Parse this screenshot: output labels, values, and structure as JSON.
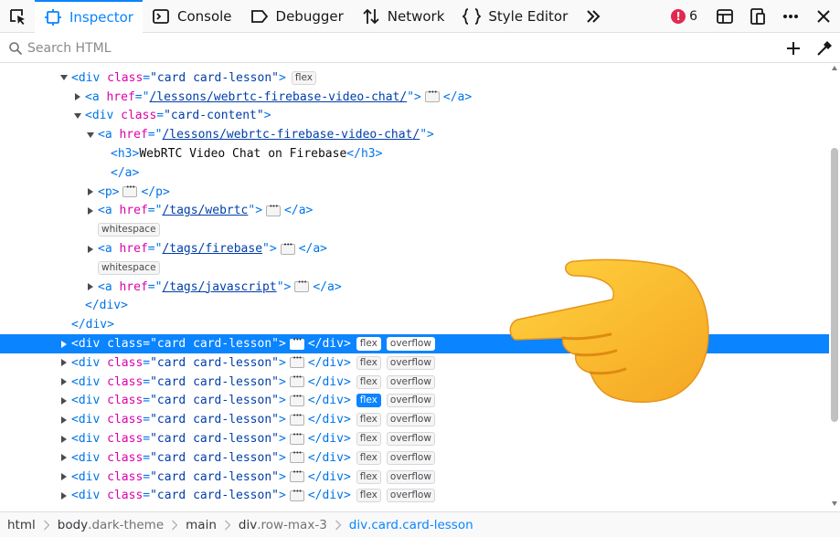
{
  "toolbar": {
    "tabs": [
      {
        "label": "Inspector",
        "icon": "inspector-icon"
      },
      {
        "label": "Console",
        "icon": "console-icon"
      },
      {
        "label": "Debugger",
        "icon": "debugger-icon"
      },
      {
        "label": "Network",
        "icon": "network-icon"
      },
      {
        "label": "Style Editor",
        "icon": "style-editor-icon"
      }
    ],
    "error_count": "6"
  },
  "search": {
    "placeholder": "Search HTML"
  },
  "tree": {
    "rows": [
      {
        "tw": "open",
        "segs": [
          [
            "punct",
            "<"
          ],
          [
            "tagn",
            "div"
          ],
          [
            "sp",
            " "
          ],
          [
            "attrn",
            "class"
          ],
          [
            "punct",
            "="
          ],
          [
            "attrv",
            "\"card card-lesson\""
          ],
          [
            "punct",
            ">"
          ]
        ],
        "badges": [
          "flex"
        ]
      },
      {
        "tw": "closed",
        "segs": [
          [
            "punct",
            "<"
          ],
          [
            "tagn",
            "a"
          ],
          [
            "sp",
            " "
          ],
          [
            "attrn",
            "href"
          ],
          [
            "punct",
            "=\""
          ],
          [
            "link",
            "/lessons/webrtc-firebase-video-chat/"
          ],
          [
            "punct",
            "\">"
          ]
        ],
        "ell": true,
        "tail": [
          [
            "punct",
            "</"
          ],
          [
            "tagn",
            "a"
          ],
          [
            "punct",
            ">"
          ]
        ]
      },
      {
        "tw": "open",
        "segs": [
          [
            "punct",
            "<"
          ],
          [
            "tagn",
            "div"
          ],
          [
            "sp",
            " "
          ],
          [
            "attrn",
            "class"
          ],
          [
            "punct",
            "="
          ],
          [
            "attrv",
            "\"card-content\""
          ],
          [
            "punct",
            ">"
          ]
        ]
      },
      {
        "tw": "open",
        "segs": [
          [
            "punct",
            "<"
          ],
          [
            "tagn",
            "a"
          ],
          [
            "sp",
            " "
          ],
          [
            "attrn",
            "href"
          ],
          [
            "punct",
            "=\""
          ],
          [
            "link",
            "/lessons/webrtc-firebase-video-chat/"
          ],
          [
            "punct",
            "\">"
          ]
        ]
      },
      {
        "tw": "none",
        "segs": [
          [
            "punct",
            "<"
          ],
          [
            "tagn",
            "h3"
          ],
          [
            "punct",
            ">"
          ],
          [
            "txt",
            "WebRTC Video Chat on Firebase"
          ],
          [
            "punct",
            "</"
          ],
          [
            "tagn",
            "h3"
          ],
          [
            "punct",
            ">"
          ]
        ]
      },
      {
        "tw": "none",
        "segs": [
          [
            "punct",
            "</"
          ],
          [
            "tagn",
            "a"
          ],
          [
            "punct",
            ">"
          ]
        ]
      },
      {
        "tw": "closed",
        "segs": [
          [
            "punct",
            "<"
          ],
          [
            "tagn",
            "p"
          ],
          [
            "punct",
            ">"
          ]
        ],
        "ell": true,
        "tail": [
          [
            "punct",
            "</"
          ],
          [
            "tagn",
            "p"
          ],
          [
            "punct",
            ">"
          ]
        ]
      },
      {
        "tw": "closed",
        "segs": [
          [
            "punct",
            "<"
          ],
          [
            "tagn",
            "a"
          ],
          [
            "sp",
            " "
          ],
          [
            "attrn",
            "href"
          ],
          [
            "punct",
            "=\""
          ],
          [
            "link",
            "/tags/webrtc"
          ],
          [
            "punct",
            "\">"
          ]
        ],
        "ell": true,
        "tail": [
          [
            "punct",
            "</"
          ],
          [
            "tagn",
            "a"
          ],
          [
            "punct",
            ">"
          ]
        ]
      },
      {
        "tw": "ws",
        "ws": "whitespace"
      },
      {
        "tw": "closed",
        "segs": [
          [
            "punct",
            "<"
          ],
          [
            "tagn",
            "a"
          ],
          [
            "sp",
            " "
          ],
          [
            "attrn",
            "href"
          ],
          [
            "punct",
            "=\""
          ],
          [
            "link",
            "/tags/firebase"
          ],
          [
            "punct",
            "\">"
          ]
        ],
        "ell": true,
        "tail": [
          [
            "punct",
            "</"
          ],
          [
            "tagn",
            "a"
          ],
          [
            "punct",
            ">"
          ]
        ]
      },
      {
        "tw": "ws",
        "ws": "whitespace"
      },
      {
        "tw": "closed",
        "segs": [
          [
            "punct",
            "<"
          ],
          [
            "tagn",
            "a"
          ],
          [
            "sp",
            " "
          ],
          [
            "attrn",
            "href"
          ],
          [
            "punct",
            "=\""
          ],
          [
            "link",
            "/tags/javascript"
          ],
          [
            "punct",
            "\">"
          ]
        ],
        "ell": true,
        "tail": [
          [
            "punct",
            "</"
          ],
          [
            "tagn",
            "a"
          ],
          [
            "punct",
            ">"
          ]
        ]
      },
      {
        "tw": "none",
        "segs": [
          [
            "punct",
            "</"
          ],
          [
            "tagn",
            "div"
          ],
          [
            "punct",
            ">"
          ]
        ]
      },
      {
        "tw": "none",
        "segs": [
          [
            "punct",
            "</"
          ],
          [
            "tagn",
            "div"
          ],
          [
            "punct",
            ">"
          ]
        ]
      },
      {
        "tw": "closed",
        "selected": true,
        "segs": [
          [
            "punct",
            "<"
          ],
          [
            "tagn",
            "div"
          ],
          [
            "sp",
            " "
          ],
          [
            "attrn",
            "class"
          ],
          [
            "punct",
            "="
          ],
          [
            "attrv",
            "\"card card-lesson\""
          ],
          [
            "punct",
            ">"
          ]
        ],
        "ell": true,
        "tail": [
          [
            "punct",
            "</"
          ],
          [
            "tagn",
            "div"
          ],
          [
            "punct",
            ">"
          ]
        ],
        "badges": [
          "flex",
          "overflow"
        ]
      },
      {
        "tw": "closed",
        "segs": [
          [
            "punct",
            "<"
          ],
          [
            "tagn",
            "div"
          ],
          [
            "sp",
            " "
          ],
          [
            "attrn",
            "class"
          ],
          [
            "punct",
            "="
          ],
          [
            "attrv",
            "\"card card-lesson\""
          ],
          [
            "punct",
            ">"
          ]
        ],
        "ell": true,
        "tail": [
          [
            "punct",
            "</"
          ],
          [
            "tagn",
            "div"
          ],
          [
            "punct",
            ">"
          ]
        ],
        "badges": [
          "flex",
          "overflow"
        ]
      },
      {
        "tw": "closed",
        "segs": [
          [
            "punct",
            "<"
          ],
          [
            "tagn",
            "div"
          ],
          [
            "sp",
            " "
          ],
          [
            "attrn",
            "class"
          ],
          [
            "punct",
            "="
          ],
          [
            "attrv",
            "\"card card-lesson\""
          ],
          [
            "punct",
            ">"
          ]
        ],
        "ell": true,
        "tail": [
          [
            "punct",
            "</"
          ],
          [
            "tagn",
            "div"
          ],
          [
            "punct",
            ">"
          ]
        ],
        "badges": [
          "flex",
          "overflow"
        ]
      },
      {
        "tw": "closed",
        "segs": [
          [
            "punct",
            "<"
          ],
          [
            "tagn",
            "div"
          ],
          [
            "sp",
            " "
          ],
          [
            "attrn",
            "class"
          ],
          [
            "punct",
            "="
          ],
          [
            "attrv",
            "\"card card-lesson\""
          ],
          [
            "punct",
            ">"
          ]
        ],
        "ell": true,
        "tail": [
          [
            "punct",
            "</"
          ],
          [
            "tagn",
            "div"
          ],
          [
            "punct",
            ">"
          ]
        ],
        "badges": [
          "flex",
          "overflow"
        ],
        "active_badge": "flex"
      },
      {
        "tw": "closed",
        "segs": [
          [
            "punct",
            "<"
          ],
          [
            "tagn",
            "div"
          ],
          [
            "sp",
            " "
          ],
          [
            "attrn",
            "class"
          ],
          [
            "punct",
            "="
          ],
          [
            "attrv",
            "\"card card-lesson\""
          ],
          [
            "punct",
            ">"
          ]
        ],
        "ell": true,
        "tail": [
          [
            "punct",
            "</"
          ],
          [
            "tagn",
            "div"
          ],
          [
            "punct",
            ">"
          ]
        ],
        "badges": [
          "flex",
          "overflow"
        ]
      },
      {
        "tw": "closed",
        "segs": [
          [
            "punct",
            "<"
          ],
          [
            "tagn",
            "div"
          ],
          [
            "sp",
            " "
          ],
          [
            "attrn",
            "class"
          ],
          [
            "punct",
            "="
          ],
          [
            "attrv",
            "\"card card-lesson\""
          ],
          [
            "punct",
            ">"
          ]
        ],
        "ell": true,
        "tail": [
          [
            "punct",
            "</"
          ],
          [
            "tagn",
            "div"
          ],
          [
            "punct",
            ">"
          ]
        ],
        "badges": [
          "flex",
          "overflow"
        ]
      },
      {
        "tw": "closed",
        "segs": [
          [
            "punct",
            "<"
          ],
          [
            "tagn",
            "div"
          ],
          [
            "sp",
            " "
          ],
          [
            "attrn",
            "class"
          ],
          [
            "punct",
            "="
          ],
          [
            "attrv",
            "\"card card-lesson\""
          ],
          [
            "punct",
            ">"
          ]
        ],
        "ell": true,
        "tail": [
          [
            "punct",
            "</"
          ],
          [
            "tagn",
            "div"
          ],
          [
            "punct",
            ">"
          ]
        ],
        "badges": [
          "flex",
          "overflow"
        ]
      },
      {
        "tw": "closed",
        "segs": [
          [
            "punct",
            "<"
          ],
          [
            "tagn",
            "div"
          ],
          [
            "sp",
            " "
          ],
          [
            "attrn",
            "class"
          ],
          [
            "punct",
            "="
          ],
          [
            "attrv",
            "\"card card-lesson\""
          ],
          [
            "punct",
            ">"
          ]
        ],
        "ell": true,
        "tail": [
          [
            "punct",
            "</"
          ],
          [
            "tagn",
            "div"
          ],
          [
            "punct",
            ">"
          ]
        ],
        "badges": [
          "flex",
          "overflow"
        ]
      },
      {
        "tw": "closed",
        "segs": [
          [
            "punct",
            "<"
          ],
          [
            "tagn",
            "div"
          ],
          [
            "sp",
            " "
          ],
          [
            "attrn",
            "class"
          ],
          [
            "punct",
            "="
          ],
          [
            "attrv",
            "\"card card-lesson\""
          ],
          [
            "punct",
            ">"
          ]
        ],
        "ell": true,
        "tail": [
          [
            "punct",
            "</"
          ],
          [
            "tagn",
            "div"
          ],
          [
            "punct",
            ">"
          ]
        ],
        "badges": [
          "flex",
          "overflow"
        ]
      }
    ]
  },
  "breadcrumbs": [
    {
      "tag": "html",
      "cls": ""
    },
    {
      "tag": "body",
      "cls": ".dark-theme"
    },
    {
      "tag": "main",
      "cls": ""
    },
    {
      "tag": "div",
      "cls": ".row-max-3"
    },
    {
      "tag": "div",
      "cls": ".card.card-lesson",
      "selected": true
    }
  ],
  "colors": {
    "accent": "#0a84ff",
    "tag": "#0074e8",
    "attr_name": "#dd00a9",
    "attr_value": "#003eaa",
    "error": "#e22850"
  }
}
